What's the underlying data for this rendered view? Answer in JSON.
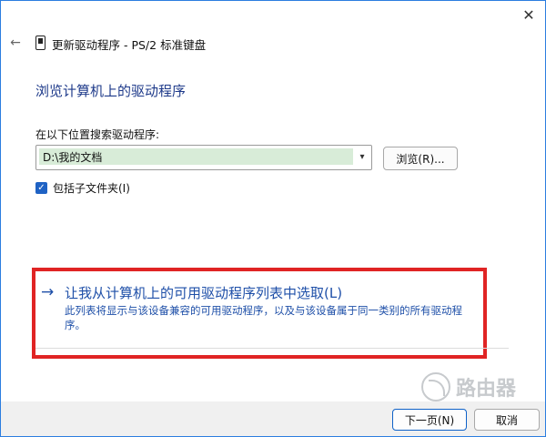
{
  "window": {
    "title": "更新驱动程序 - PS/2 标准键盘",
    "close_glyph": "✕",
    "back_glyph": "←"
  },
  "page": {
    "heading": "浏览计算机上的驱动程序",
    "search_label": "在以下位置搜索驱动程序:",
    "path_value": "D:\\我的文档",
    "browse_label": "浏览(R)...",
    "include_subfolders_label": "包括子文件夹(I)",
    "include_subfolders_checked": true,
    "pick_link": {
      "arrow": "→",
      "title": "让我从计算机上的可用驱动程序列表中选取(L)",
      "description": "此列表将显示与该设备兼容的可用驱动程序，以及与该设备属于同一类别的所有驱动程序。"
    }
  },
  "footer": {
    "next_label": "下一页(N)",
    "cancel_label": "取消"
  },
  "watermark": {
    "text": "路由器"
  },
  "colors": {
    "accent": "#1f62c4",
    "heading": "#1e3a8a",
    "link": "#1e4fa8",
    "highlight": "#e02424",
    "field_highlight": "#d8ecd8"
  }
}
